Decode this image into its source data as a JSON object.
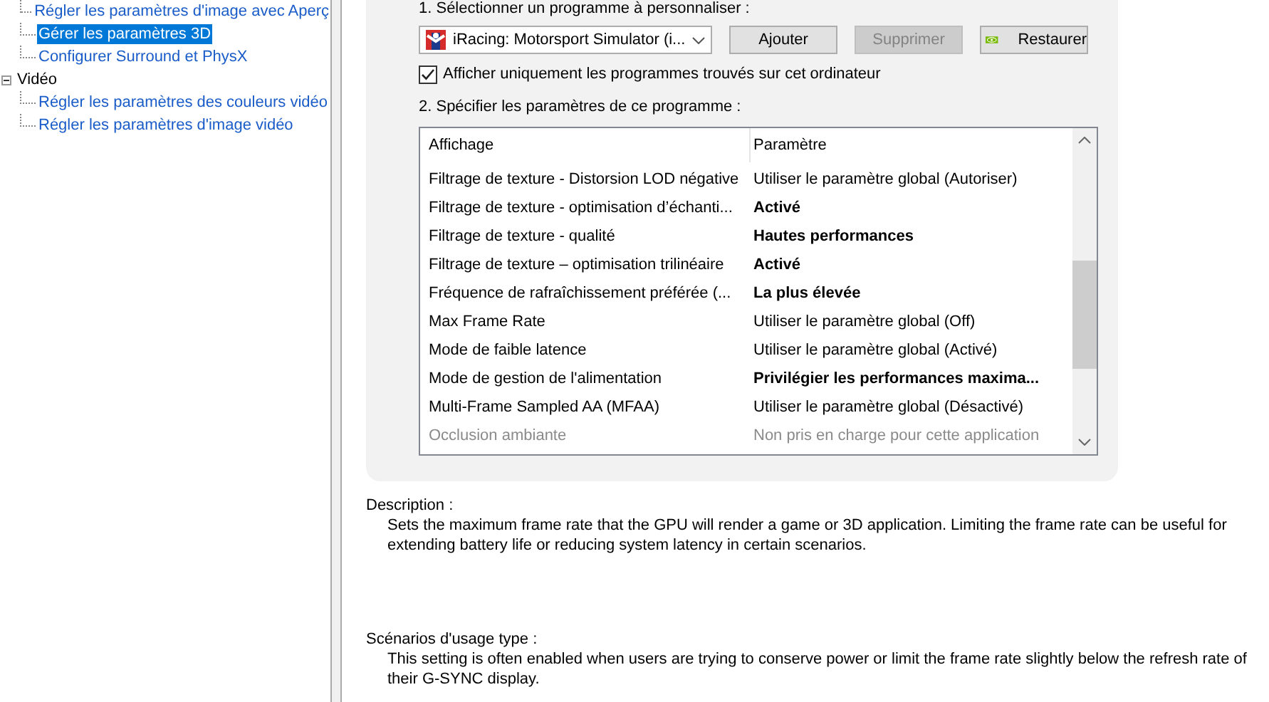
{
  "tree": [
    {
      "label": "Régler les paramètres d'image avec Aperç",
      "selected": false
    },
    {
      "label": "Gérer les paramètres 3D",
      "selected": true
    },
    {
      "label": "Configurer Surround et PhysX",
      "selected": false
    },
    {
      "label": "Vidéo",
      "selected": false,
      "expanded": true,
      "children": [
        {
          "label": "Régler les paramètres des couleurs vidéo",
          "selected": false
        },
        {
          "label": "Régler les paramètres d'image vidéo",
          "selected": false
        }
      ]
    }
  ],
  "step1": "1. Sélectionner un programme à personnaliser :",
  "program": {
    "value": "iRacing: Motorsport Simulator (i..."
  },
  "buttons": [
    {
      "label": "Ajouter",
      "disabled": false
    },
    {
      "label": "Supprimer",
      "disabled": true
    },
    {
      "label": "Restaurer",
      "disabled": false,
      "kind": "logo"
    }
  ],
  "only_found": {
    "label": "Afficher uniquement les programmes trouvés sur cet ordinateur",
    "checked": true
  },
  "step2": "2. Spécifier les paramètres de ce programme :",
  "table": {
    "columns": [
      "Affichage",
      "Paramètre"
    ],
    "rows": [
      {
        "feature": "Filtrage de texture - Distorsion LOD négative",
        "setting": "Utiliser le paramètre global (Autoriser)",
        "bold": false,
        "disabled": false
      },
      {
        "feature": "Filtrage de texture - optimisation d’échanti...",
        "setting": "Activé",
        "bold": true,
        "disabled": false
      },
      {
        "feature": "Filtrage de texture - qualité",
        "setting": "Hautes performances",
        "bold": true,
        "disabled": false
      },
      {
        "feature": "Filtrage de texture – optimisation trilinéaire",
        "setting": "Activé",
        "bold": true,
        "disabled": false
      },
      {
        "feature": "Fréquence de rafraîchissement préférée (...",
        "setting": "La plus élevée",
        "bold": true,
        "disabled": false
      },
      {
        "feature": "Max Frame Rate",
        "setting": "Utiliser le paramètre global (Off)",
        "bold": false,
        "disabled": false
      },
      {
        "feature": "Mode de faible latence",
        "setting": "Utiliser le paramètre global (Activé)",
        "bold": false,
        "disabled": false
      },
      {
        "feature": "Mode de gestion de l'alimentation",
        "setting": "Privilégier les performances maxima...",
        "bold": true,
        "disabled": false
      },
      {
        "feature": "Multi-Frame Sampled AA (MFAA)",
        "setting": "Utiliser le paramètre global (Désactivé)",
        "bold": false,
        "disabled": false
      },
      {
        "feature": "Occlusion ambiante",
        "setting": "Non pris en charge pour cette application",
        "bold": false,
        "disabled": true
      }
    ]
  },
  "description": {
    "title": "Description :",
    "text": "Sets the maximum frame rate that the GPU will render a game or 3D application. Limiting the frame rate can be useful for extending battery life or reducing system latency in certain scenarios."
  },
  "usage": {
    "title": "Scénarios d'usage type :",
    "text": "This setting is often enabled when users are trying to conserve power or limit the frame rate slightly below the refresh rate of their G-SYNC display."
  }
}
